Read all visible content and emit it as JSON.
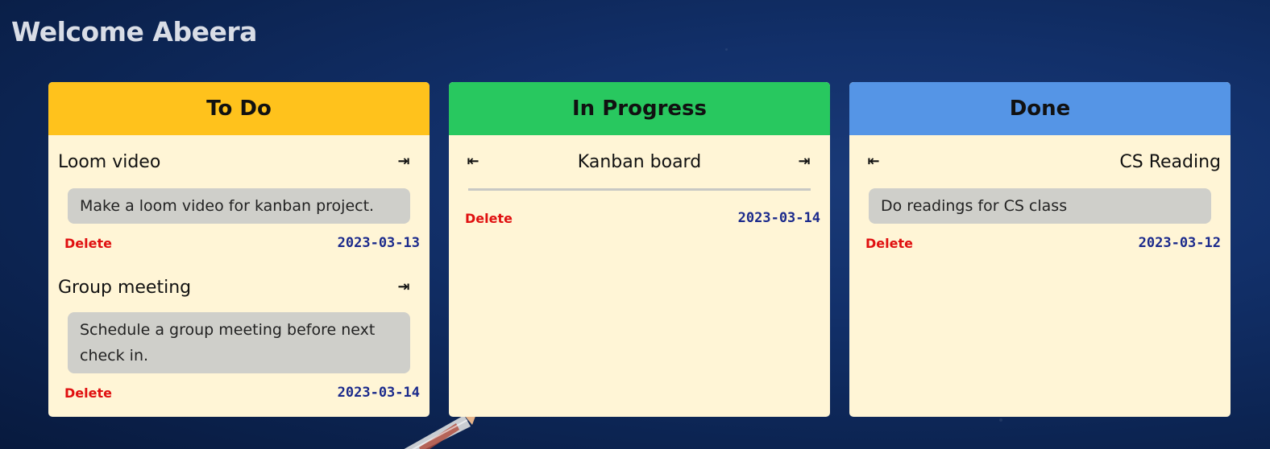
{
  "welcome": "Welcome Abeera",
  "arrows": {
    "left": "⇤",
    "right": "⇥"
  },
  "columns": [
    {
      "title": "To Do",
      "color": "#ffc21c",
      "cards": [
        {
          "title": "Loom video",
          "description": "Make a loom video for kanban project.",
          "delete": "Delete",
          "date": "2023-03-13"
        },
        {
          "title": "Group meeting",
          "description": "Schedule a group meeting before next check in.",
          "delete": "Delete",
          "date": "2023-03-14"
        }
      ]
    },
    {
      "title": "In Progress",
      "color": "#28c85f",
      "cards": [
        {
          "title": "Kanban board",
          "description": "",
          "delete": "Delete",
          "date": "2023-03-14"
        }
      ]
    },
    {
      "title": "Done",
      "color": "#5595e6",
      "cards": [
        {
          "title": "CS Reading",
          "description": "Do readings for CS class",
          "delete": "Delete",
          "date": "2023-03-12"
        }
      ]
    }
  ]
}
